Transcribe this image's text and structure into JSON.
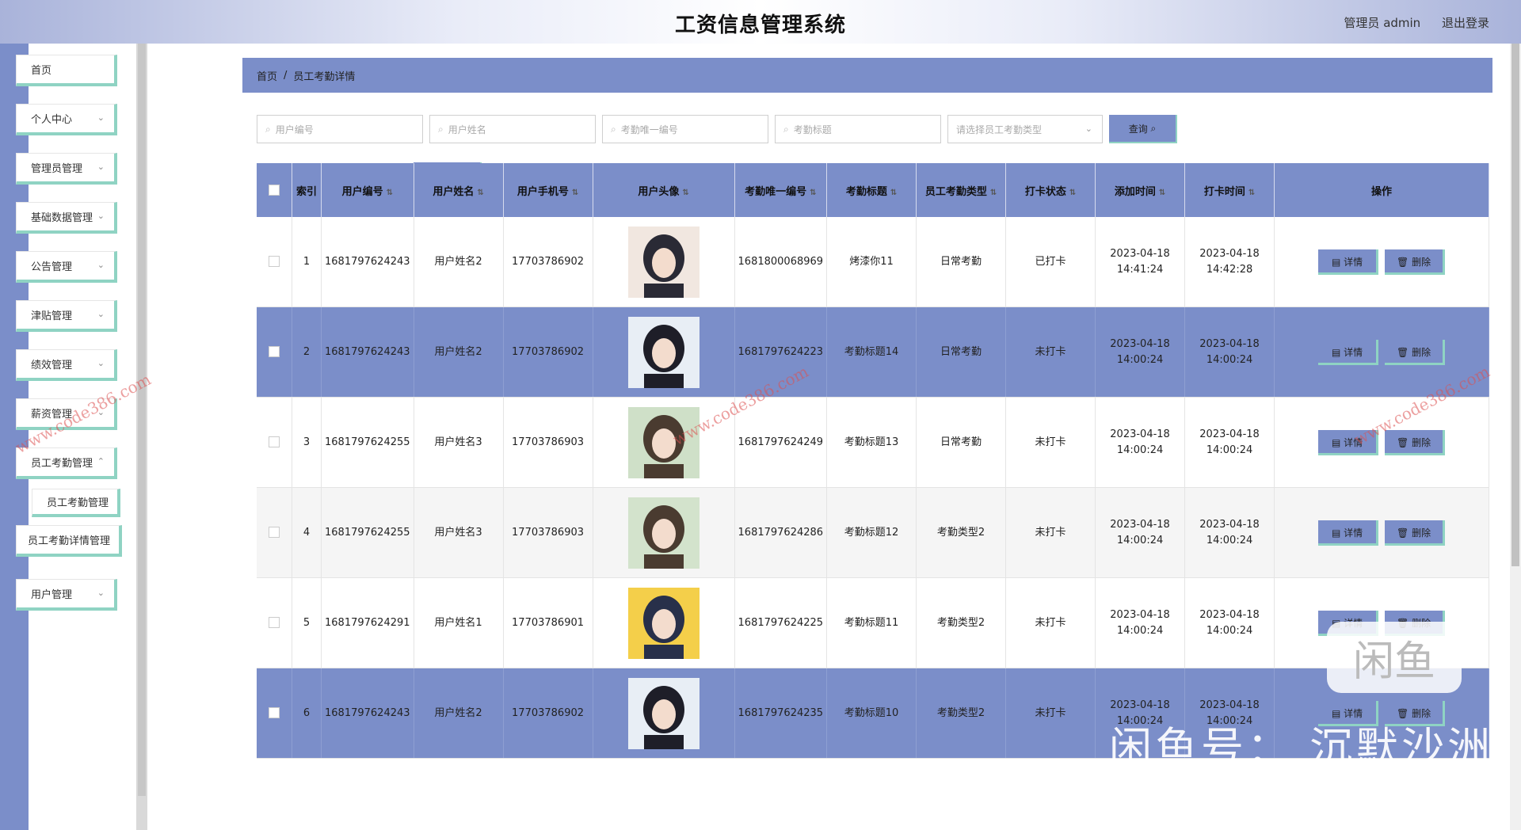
{
  "app": {
    "title": "工资信息管理系统",
    "user": "管理员 admin",
    "logout": "退出登录"
  },
  "sidebar": {
    "items": [
      {
        "label": "首页"
      },
      {
        "label": "个人中心"
      },
      {
        "label": "管理员管理"
      },
      {
        "label": "基础数据管理"
      },
      {
        "label": "公告管理"
      },
      {
        "label": "津贴管理"
      },
      {
        "label": "绩效管理"
      },
      {
        "label": "薪资管理"
      },
      {
        "label": "员工考勤管理"
      },
      {
        "label": "员工考勤管理"
      },
      {
        "label": "员工考勤详情管理"
      },
      {
        "label": "用户管理"
      }
    ]
  },
  "breadcrumb": {
    "home": "首页",
    "sep": "/",
    "current": "员工考勤详情"
  },
  "search": {
    "user_no": "用户编号",
    "user_name": "用户姓名",
    "att_no": "考勤唯一编号",
    "att_title": "考勤标题",
    "type_select": "请选择员工考勤类型",
    "query_label": "查询"
  },
  "actions": {
    "delete_label": "删除"
  },
  "table": {
    "headers": [
      "索引",
      "用户编号",
      "用户姓名",
      "用户手机号",
      "用户头像",
      "考勤唯一编号",
      "考勤标题",
      "员工考勤类型",
      "打卡状态",
      "添加时间",
      "打卡时间",
      "操作"
    ],
    "detail_label": "详情",
    "delete_label": "删除",
    "rows": [
      {
        "idx": "1",
        "user_no": "1681797624243",
        "name": "用户姓名2",
        "phone": "17703786902",
        "att_no": "1681800068969",
        "title": "烤漆你11",
        "type": "日常考勤",
        "status": "已打卡",
        "added": "2023-04-18 14:41:24",
        "clock": "2023-04-18 14:42:28"
      },
      {
        "idx": "2",
        "user_no": "1681797624243",
        "name": "用户姓名2",
        "phone": "17703786902",
        "att_no": "1681797624223",
        "title": "考勤标题14",
        "type": "日常考勤",
        "status": "未打卡",
        "added": "2023-04-18 14:00:24",
        "clock": "2023-04-18 14:00:24"
      },
      {
        "idx": "3",
        "user_no": "1681797624255",
        "name": "用户姓名3",
        "phone": "17703786903",
        "att_no": "1681797624249",
        "title": "考勤标题13",
        "type": "日常考勤",
        "status": "未打卡",
        "added": "2023-04-18 14:00:24",
        "clock": "2023-04-18 14:00:24"
      },
      {
        "idx": "4",
        "user_no": "1681797624255",
        "name": "用户姓名3",
        "phone": "17703786903",
        "att_no": "1681797624286",
        "title": "考勤标题12",
        "type": "考勤类型2",
        "status": "未打卡",
        "added": "2023-04-18 14:00:24",
        "clock": "2023-04-18 14:00:24"
      },
      {
        "idx": "5",
        "user_no": "1681797624291",
        "name": "用户姓名1",
        "phone": "17703786901",
        "att_no": "1681797624225",
        "title": "考勤标题11",
        "type": "考勤类型2",
        "status": "未打卡",
        "added": "2023-04-18 14:00:24",
        "clock": "2023-04-18 14:00:24"
      },
      {
        "idx": "6",
        "user_no": "1681797624243",
        "name": "用户姓名2",
        "phone": "17703786902",
        "att_no": "1681797624235",
        "title": "考勤标题10",
        "type": "考勤类型2",
        "status": "未打卡",
        "added": "2023-04-18 14:00:24",
        "clock": "2023-04-18 14:00:24"
      }
    ]
  },
  "watermarks": {
    "site": "www.code386.com",
    "overlay": "闲鱼号：  沉默沙洲",
    "logo": "闲鱼"
  }
}
